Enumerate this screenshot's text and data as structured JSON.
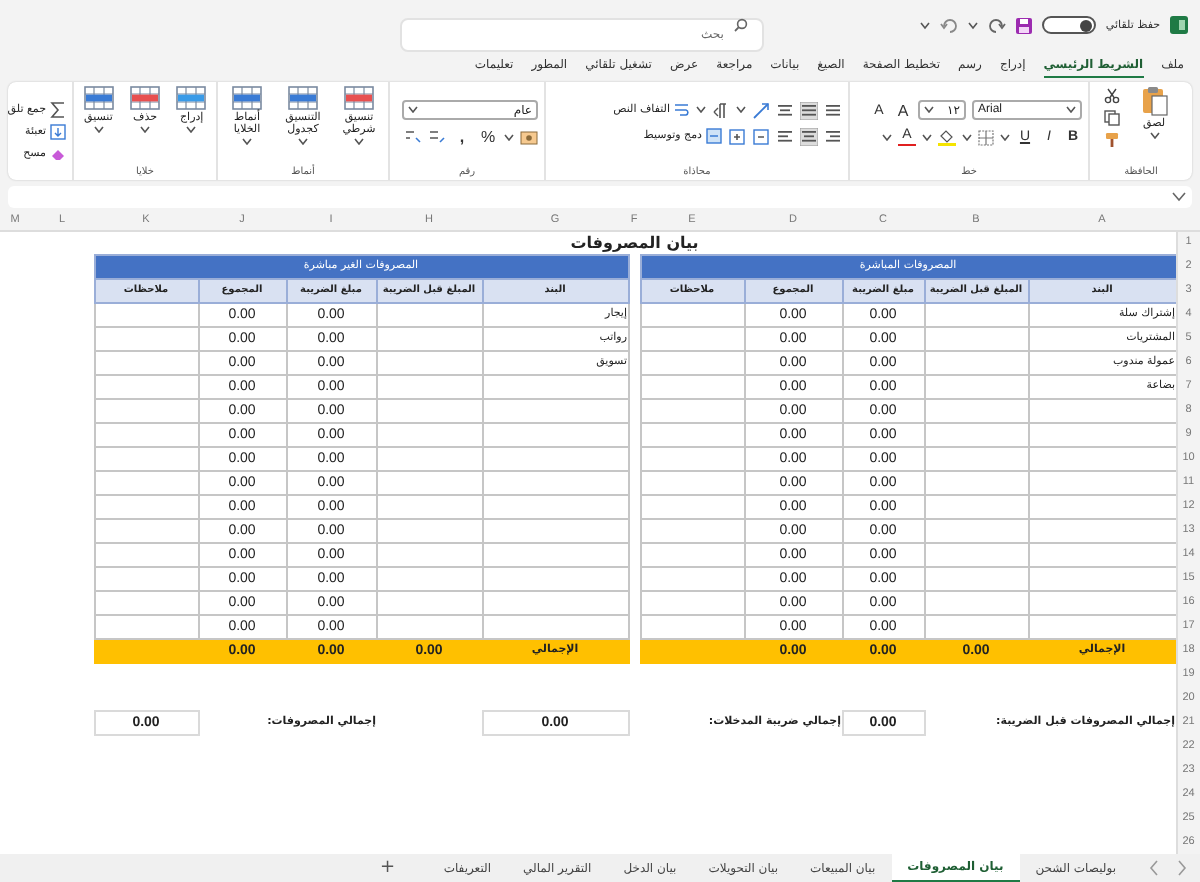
{
  "topbar": {
    "autosave_label": "حفظ تلقائي",
    "autosave_on": false,
    "search": {
      "placeholder": "بحث"
    }
  },
  "menu_tabs": [
    {
      "label": "ملف",
      "selected": false
    },
    {
      "label": "الشريط الرئيسي",
      "selected": true
    },
    {
      "label": "إدراج",
      "selected": false
    },
    {
      "label": "رسم",
      "selected": false
    },
    {
      "label": "تخطيط الصفحة",
      "selected": false
    },
    {
      "label": "الصيغ",
      "selected": false
    },
    {
      "label": "بيانات",
      "selected": false
    },
    {
      "label": "مراجعة",
      "selected": false
    },
    {
      "label": "عرض",
      "selected": false
    },
    {
      "label": "تشغيل تلقائي",
      "selected": false
    },
    {
      "label": "المطور",
      "selected": false
    },
    {
      "label": "تعليمات",
      "selected": false
    }
  ],
  "ribbon": {
    "groups": [
      {
        "kind": "clipboard",
        "label": "الحافظة",
        "paste": "لصق"
      },
      {
        "kind": "font",
        "label": "خط",
        "font": "Arial",
        "size": "١٢",
        "grow": "A",
        "shrink": "A",
        "bold": "B",
        "italic": "I",
        "underline": "U",
        "color_letter": "A"
      },
      {
        "kind": "alignment",
        "label": "محاذاة",
        "wrap": "التفاف النص",
        "merge": "دمج وتوسيط"
      },
      {
        "kind": "number",
        "label": "رقم",
        "format": "عام",
        "percent": "%",
        "comma": ","
      },
      {
        "kind": "styles",
        "label": "أنماط",
        "buttons": [
          "تنسيق شرطي",
          "التنسيق كجدول",
          "أنماط الخلايا"
        ]
      },
      {
        "kind": "cells",
        "label": "خلايا",
        "buttons": [
          "إدراج",
          "حذف",
          "تنسيق"
        ]
      },
      {
        "kind": "editing",
        "buttons": [
          "جمع تلق",
          "تعبئة",
          "مسح"
        ]
      }
    ]
  },
  "columns": [
    "A",
    "B",
    "C",
    "D",
    "E",
    "F",
    "G",
    "H",
    "I",
    "J",
    "K",
    "L",
    "M"
  ],
  "row_numbers": [
    "1",
    "2",
    "3",
    "4",
    "5",
    "6",
    "7",
    "8",
    "9",
    "10",
    "11",
    "12",
    "13",
    "14",
    "15",
    "16",
    "17",
    "18",
    "19",
    "20",
    "21",
    "22",
    "23",
    "24",
    "25",
    "26"
  ],
  "sheet": {
    "title": "بيان المصروفات",
    "tables": [
      {
        "title": "المصروفات المباشرة",
        "columns": [
          "البند",
          "المبلغ قبل الضريبة",
          "مبلغ الضريبة",
          "المجموع",
          "ملاحظات"
        ],
        "rows": [
          {
            "item": "إشتراك سلة",
            "tax": "0.00",
            "total": "0.00"
          },
          {
            "item": "المشتريات",
            "tax": "0.00",
            "total": "0.00"
          },
          {
            "item": "عمولة مندوب",
            "tax": "0.00",
            "total": "0.00"
          },
          {
            "item": "بضاعة",
            "tax": "0.00",
            "total": "0.00"
          },
          {
            "tax": "0.00",
            "total": "0.00"
          },
          {
            "tax": "0.00",
            "total": "0.00"
          },
          {
            "tax": "0.00",
            "total": "0.00"
          },
          {
            "tax": "0.00",
            "total": "0.00"
          },
          {
            "tax": "0.00",
            "total": "0.00"
          },
          {
            "tax": "0.00",
            "total": "0.00"
          },
          {
            "tax": "0.00",
            "total": "0.00"
          },
          {
            "tax": "0.00",
            "total": "0.00"
          },
          {
            "tax": "0.00",
            "total": "0.00"
          },
          {
            "tax": "0.00",
            "total": "0.00"
          }
        ],
        "total": {
          "label": "الإجمالي",
          "values": [
            "0.00",
            "0.00",
            "0.00"
          ]
        }
      },
      {
        "title": "المصروفات الغير مباشرة",
        "columns": [
          "البند",
          "المبلغ قبل الضريبة",
          "مبلغ الضريبة",
          "المجموع",
          "ملاحظات"
        ],
        "rows": [
          {
            "item": "إيجار",
            "tax": "0.00",
            "total": "0.00"
          },
          {
            "item": "رواتب",
            "tax": "0.00",
            "total": "0.00"
          },
          {
            "item": "تسويق",
            "tax": "0.00",
            "total": "0.00"
          },
          {
            "tax": "0.00",
            "total": "0.00"
          },
          {
            "tax": "0.00",
            "total": "0.00"
          },
          {
            "tax": "0.00",
            "total": "0.00"
          },
          {
            "tax": "0.00",
            "total": "0.00"
          },
          {
            "tax": "0.00",
            "total": "0.00"
          },
          {
            "tax": "0.00",
            "total": "0.00"
          },
          {
            "tax": "0.00",
            "total": "0.00"
          },
          {
            "tax": "0.00",
            "total": "0.00"
          },
          {
            "tax": "0.00",
            "total": "0.00"
          },
          {
            "tax": "0.00",
            "total": "0.00"
          },
          {
            "tax": "0.00",
            "total": "0.00"
          }
        ],
        "total": {
          "label": "الإجمالي",
          "values": [
            "0.00",
            "0.00",
            "0.00"
          ]
        }
      }
    ],
    "summary": [
      {
        "label": "إجمالي المصروفات قبل الضريبة:",
        "value": "0.00"
      },
      {
        "label": "إجمالي ضريبة المدخلات:",
        "value": "0.00"
      },
      {
        "label": "إجمالي المصروفات:",
        "value": "0.00"
      }
    ]
  },
  "sheet_tabs": [
    {
      "label": "بوليصات الشحن",
      "selected": false
    },
    {
      "label": "بيان المصروفات",
      "selected": true
    },
    {
      "label": "بيان المبيعات",
      "selected": false
    },
    {
      "label": "بيان التحويلات",
      "selected": false
    },
    {
      "label": "بيان الدخل",
      "selected": false
    },
    {
      "label": "التقرير المالي",
      "selected": false
    },
    {
      "label": "التعريفات",
      "selected": false
    }
  ],
  "add_sheet": "+"
}
